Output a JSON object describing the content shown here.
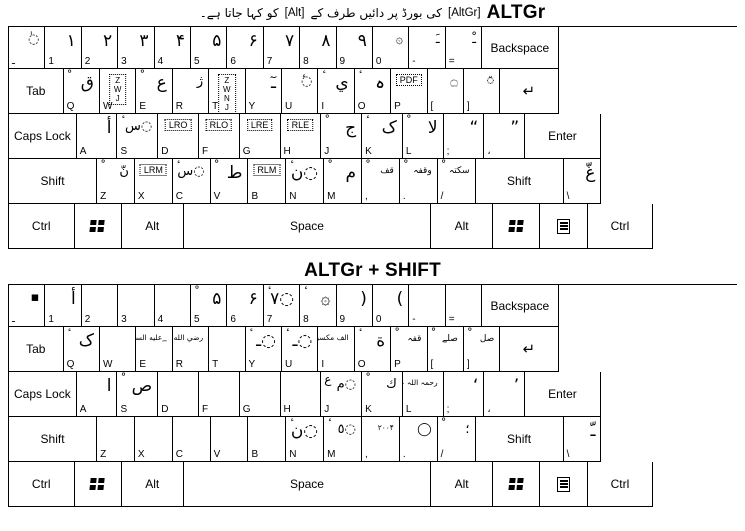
{
  "header": {
    "urdu_caption_right": "کی بورڈ پر دائیں طرف کے",
    "tag_altgr": "[AltGr]",
    "tag_alt": "[Alt]",
    "urdu_caption_left": "کو کہا جاتا ہے۔",
    "title_1": "ALTGr",
    "title_2": "ALTGr + SHIFT"
  },
  "legends": {
    "tab": "Tab",
    "caps_lock": "Caps Lock",
    "shift": "Shift",
    "ctrl": "Ctrl",
    "alt": "Alt",
    "space": "Space",
    "enter": "Enter",
    "backspace": "Backspace",
    "enter_arrow": "↵",
    "tab_arrow": "⇤",
    "windows_icon": "windows-icon",
    "menu_icon": "context-menu-icon"
  },
  "colors": {
    "border": "#000000",
    "background": "#ffffff",
    "text": "#000000"
  },
  "altgr": {
    "row1": [
      {
        "base": "ـ",
        "main": "◌ٰ",
        "size": "sm"
      },
      {
        "base": "1",
        "main": "۱"
      },
      {
        "base": "2",
        "main": "۲"
      },
      {
        "base": "3",
        "main": "۳"
      },
      {
        "base": "4",
        "main": "۴"
      },
      {
        "base": "5",
        "main": "۵"
      },
      {
        "base": "6",
        "main": "۶"
      },
      {
        "base": "7",
        "main": "۷"
      },
      {
        "base": "8",
        "main": "۸"
      },
      {
        "base": "9",
        "main": "۹"
      },
      {
        "base": "0",
        "main": "۞",
        "size": "sm"
      },
      {
        "base": "-",
        "main": "ـَ",
        "size": "sm"
      },
      {
        "base": "=",
        "main": "ـْ",
        "size": "sm"
      },
      {
        "base": "",
        "center": "Backspace"
      }
    ],
    "row2": [
      {
        "center": "Tab"
      },
      {
        "base": "Q",
        "tick": "ْ",
        "main": "ق"
      },
      {
        "base": "W",
        "box": "Z W\nJ"
      },
      {
        "base": "E",
        "tick": "ْ",
        "main": "ع"
      },
      {
        "base": "R",
        "main": "ژ",
        "size": "sm"
      },
      {
        "base": "T",
        "box": "Z W\nN J"
      },
      {
        "base": "Y",
        "main": "ـٓ"
      },
      {
        "base": "U",
        "main": "◌ٔ",
        "size": "sm"
      },
      {
        "base": "I",
        "tick": "ٔ",
        "main": "ي"
      },
      {
        "base": "O",
        "tick": "ٔ",
        "main": "ہ"
      },
      {
        "base": "P",
        "box": "PDF"
      },
      {
        "base": "[",
        "main": "۝",
        "size": "sm"
      },
      {
        "base": "]",
        "main": "◌٘",
        "size": "sm"
      },
      {
        "base": "",
        "center_glyph": "enter-arrow"
      }
    ],
    "row3": [
      {
        "center": "Caps Lock"
      },
      {
        "base": "A",
        "main": "أ"
      },
      {
        "base": "S",
        "tick": "ٔ",
        "main": "◌س",
        "size": "sm"
      },
      {
        "base": "D",
        "box": "LRO"
      },
      {
        "base": "F",
        "box": "RLO"
      },
      {
        "base": "G",
        "box": "LRE"
      },
      {
        "base": "H",
        "box": "RLE"
      },
      {
        "base": "J",
        "tick": "ْ",
        "main": "ج"
      },
      {
        "base": "K",
        "tick": "ٔ",
        "main": "ک"
      },
      {
        "base": "L",
        "tick": "ْ",
        "main": "لا"
      },
      {
        "base": ";",
        "main": "“"
      },
      {
        "base": "،",
        "main": "”"
      },
      {
        "base": "",
        "center": "Enter"
      }
    ],
    "row4": [
      {
        "center": "Shift"
      },
      {
        "base": "Z",
        "tick": "ْ",
        "main": "نّ",
        "size": "sm"
      },
      {
        "base": "X",
        "box": "LRM"
      },
      {
        "base": "C",
        "tick": "ٔ",
        "main": "◌س",
        "size": "sm"
      },
      {
        "base": "V",
        "tick": "ْ",
        "main": "ط"
      },
      {
        "base": "B",
        "box": "RLM"
      },
      {
        "base": "N",
        "tick": "ٔ",
        "main": "◌ن"
      },
      {
        "base": "M",
        "tick": "ْ",
        "main": "م"
      },
      {
        "base": ",",
        "tick": "ْ",
        "main": "قف",
        "size": "xs"
      },
      {
        "base": ".",
        "tick": "ْ",
        "main": "وقفہ",
        "size": "xs"
      },
      {
        "base": "/",
        "tick": "ْ",
        "main": "سکتہ",
        "size": "xs"
      },
      {
        "base": "",
        "center": "Shift"
      },
      {
        "base": "\\",
        "main": "غّ"
      }
    ],
    "row5": [
      {
        "center": "Ctrl"
      },
      {
        "glyph": "windows-icon"
      },
      {
        "center": "Alt"
      },
      {
        "center": "Space"
      },
      {
        "center": "Alt"
      },
      {
        "glyph": "windows-icon"
      },
      {
        "glyph": "context-menu-icon"
      },
      {
        "center": "Ctrl"
      }
    ]
  },
  "altgr_shift": {
    "row1": [
      {
        "base": "ـ",
        "main": "▪",
        "size": "sm"
      },
      {
        "base": "1",
        "main": "أ"
      },
      {
        "base": "2",
        "main": ""
      },
      {
        "base": "3",
        "main": ""
      },
      {
        "base": "4",
        "main": ""
      },
      {
        "base": "5",
        "tick": "ْ",
        "main": "۵"
      },
      {
        "base": "6",
        "main": "۶"
      },
      {
        "base": "7",
        "tick": "ٔ",
        "main": "◌۷"
      },
      {
        "base": "8",
        "tick": "ٔ",
        "main": "۞"
      },
      {
        "base": "9",
        "main": "("
      },
      {
        "base": "0",
        "main": ")"
      },
      {
        "base": "-",
        "main": ""
      },
      {
        "base": "=",
        "main": ""
      },
      {
        "base": "",
        "center": "Backspace"
      }
    ],
    "row2": [
      {
        "center": "Tab"
      },
      {
        "base": "Q",
        "tick": "ٔ",
        "main": "ک"
      },
      {
        "base": "W",
        "main": ""
      },
      {
        "base": "E",
        "main": "؁عليه السلام",
        "size": "tiny"
      },
      {
        "base": "R",
        "main": "رضي الله عنه",
        "size": "tiny"
      },
      {
        "base": "T",
        "main": ""
      },
      {
        "base": "Y",
        "tick": "ٔ",
        "main": "◌ـ"
      },
      {
        "base": "U",
        "tick": "ٔ",
        "main": "◌ـ"
      },
      {
        "base": "I",
        "main": "الف مكسورہ",
        "size": "tiny"
      },
      {
        "base": "O",
        "tick": "ٔ",
        "main": "ة"
      },
      {
        "base": "P",
        "tick": "ْ",
        "main": "قفہ",
        "size": "xs"
      },
      {
        "base": "[",
        "tick": "ْ",
        "main": "صلے",
        "size": "xs"
      },
      {
        "base": "]",
        "tick": "ْ",
        "main": "صل",
        "size": "xs"
      },
      {
        "base": "",
        "center_glyph": "enter-arrow"
      }
    ],
    "row3": [
      {
        "center": "Caps Lock"
      },
      {
        "base": "A",
        "main": "ا"
      },
      {
        "base": "S",
        "tick": "ْ",
        "main": "ص"
      },
      {
        "base": "D",
        "main": ""
      },
      {
        "base": "F",
        "main": ""
      },
      {
        "base": "G",
        "main": ""
      },
      {
        "base": "H",
        "main": ""
      },
      {
        "base": "J",
        "tick": "ع",
        "main": "◌م",
        "size": "sm"
      },
      {
        "base": "K",
        "tick": "ْ",
        "main": "ك",
        "size": "sm"
      },
      {
        "base": "L",
        "main": "رحمہ اللہ عليہ",
        "size": "tiny"
      },
      {
        "base": ";",
        "main": "‘"
      },
      {
        "base": "،",
        "main": "’"
      },
      {
        "base": "",
        "center": "Enter"
      }
    ],
    "row4": [
      {
        "center": "Shift"
      },
      {
        "base": "Z",
        "main": ""
      },
      {
        "base": "X",
        "main": ""
      },
      {
        "base": "C",
        "main": ""
      },
      {
        "base": "V",
        "main": ""
      },
      {
        "base": "B",
        "main": ""
      },
      {
        "base": "N",
        "tick": "ٔ",
        "main": "◌ن"
      },
      {
        "base": "M",
        "tick": "ٔ",
        "main": "◌٥",
        "size": "sm"
      },
      {
        "base": ",",
        "main": "۲۰۰۴",
        "size": "tiny"
      },
      {
        "base": ".",
        "main": "◯",
        "size": "sm"
      },
      {
        "base": "/",
        "tick": "ْ",
        "main": "؛",
        "size": "sm"
      },
      {
        "base": "",
        "center": "Shift"
      },
      {
        "base": "\\",
        "main": "ـّ"
      }
    ],
    "row5": [
      {
        "center": "Ctrl"
      },
      {
        "glyph": "windows-icon"
      },
      {
        "center": "Alt"
      },
      {
        "center": "Space"
      },
      {
        "center": "Alt"
      },
      {
        "glyph": "windows-icon"
      },
      {
        "glyph": "context-menu-icon"
      },
      {
        "center": "Ctrl"
      }
    ]
  },
  "widths": {
    "row1": [
      5.0,
      5.0,
      5.0,
      5.0,
      5.0,
      5.0,
      5.0,
      5.0,
      5.0,
      5.0,
      5.0,
      5.0,
      5.0,
      10.5
    ],
    "row2": [
      7.5,
      5.0,
      5.0,
      5.0,
      5.0,
      5.0,
      5.0,
      5.0,
      5.0,
      5.0,
      5.0,
      5.0,
      5.0,
      8.0
    ],
    "row3": [
      9.3,
      5.6,
      5.6,
      5.6,
      5.6,
      5.6,
      5.6,
      5.6,
      5.6,
      5.6,
      5.6,
      5.6,
      10.4
    ],
    "row4": [
      12.1,
      5.2,
      5.2,
      5.2,
      5.2,
      5.2,
      5.2,
      5.2,
      5.2,
      5.2,
      5.2,
      12.1,
      5.2
    ],
    "row5": [
      9.0,
      6.5,
      8.5,
      34.0,
      8.5,
      6.5,
      6.5,
      9.0
    ]
  }
}
